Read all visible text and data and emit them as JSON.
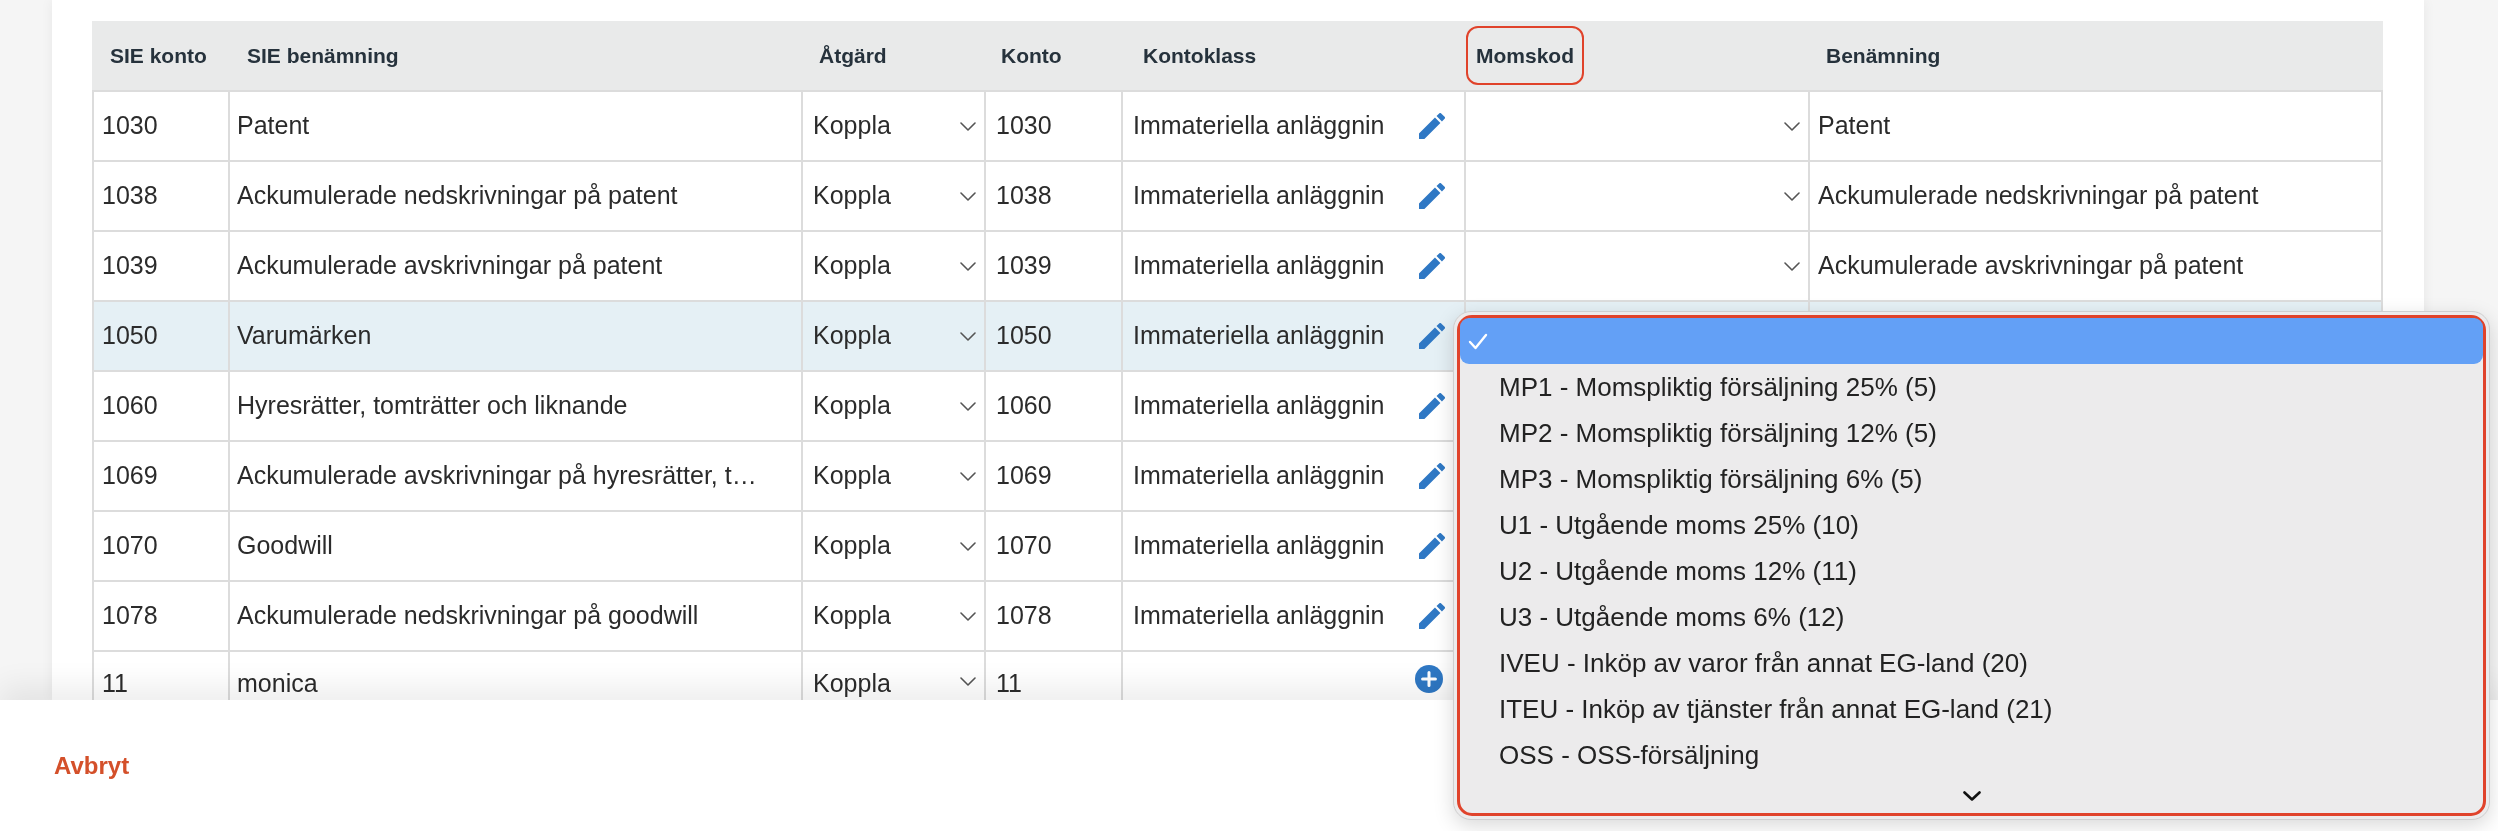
{
  "table": {
    "columns": [
      {
        "label": "SIE konto",
        "highlighted": false
      },
      {
        "label": "SIE benämning",
        "highlighted": false
      },
      {
        "label": "Åtgärd",
        "highlighted": false
      },
      {
        "label": "Konto",
        "highlighted": false
      },
      {
        "label": "Kontoklass",
        "highlighted": false
      },
      {
        "label": "Momskod",
        "highlighted": true
      },
      {
        "label": "Benämning",
        "highlighted": false
      }
    ],
    "rows": [
      {
        "sie_konto": "1030",
        "sie_benamning": "Patent",
        "atgard": "Koppla",
        "konto": "1030",
        "kontoklass": {
          "kind": "edit",
          "text": "Immateriella anläggnin"
        },
        "momskod": {
          "kind": "select"
        },
        "benamning": "Patent",
        "selected": false
      },
      {
        "sie_konto": "1038",
        "sie_benamning": "Ackumulerade nedskrivningar på patent",
        "atgard": "Koppla",
        "konto": "1038",
        "kontoklass": {
          "kind": "edit",
          "text": "Immateriella anläggnin"
        },
        "momskod": {
          "kind": "select"
        },
        "benamning": "Ackumulerade nedskrivningar på patent",
        "selected": false
      },
      {
        "sie_konto": "1039",
        "sie_benamning": "Ackumulerade avskrivningar på patent",
        "atgard": "Koppla",
        "konto": "1039",
        "kontoklass": {
          "kind": "edit",
          "text": "Immateriella anläggnin"
        },
        "momskod": {
          "kind": "select"
        },
        "benamning": "Ackumulerade avskrivningar på patent",
        "selected": false
      },
      {
        "sie_konto": "1050",
        "sie_benamning": "Varumärken",
        "atgard": "Koppla",
        "konto": "1050",
        "kontoklass": {
          "kind": "edit",
          "text": "Immateriella anläggnin"
        },
        "selected": true
      },
      {
        "sie_konto": "1060",
        "sie_benamning": "Hyresrätter, tomträtter och liknande",
        "atgard": "Koppla",
        "konto": "1060",
        "kontoklass": {
          "kind": "edit",
          "text": "Immateriella anläggnin"
        },
        "selected": false
      },
      {
        "sie_konto": "1069",
        "sie_benamning": "Ackumulerade avskrivningar på hyresrätter, t…",
        "atgard": "Koppla",
        "konto": "1069",
        "kontoklass": {
          "kind": "edit",
          "text": "Immateriella anläggnin"
        },
        "selected": false
      },
      {
        "sie_konto": "1070",
        "sie_benamning": "Goodwill",
        "atgard": "Koppla",
        "konto": "1070",
        "kontoklass": {
          "kind": "edit",
          "text": "Immateriella anläggnin"
        },
        "selected": false
      },
      {
        "sie_konto": "1078",
        "sie_benamning": "Ackumulerade nedskrivningar på goodwill",
        "atgard": "Koppla",
        "konto": "1078",
        "kontoklass": {
          "kind": "edit",
          "text": "Immateriella anläggnin"
        },
        "selected": false
      },
      {
        "sie_konto": "11",
        "sie_benamning": "monica",
        "atgard": "Koppla",
        "konto": "11",
        "kontoklass": {
          "kind": "add"
        },
        "selected": false
      }
    ]
  },
  "dropdown": {
    "highlighted": true,
    "options": [
      {
        "selected": true
      },
      {
        "label": "MP1 - Momspliktig försäljning 25% (5)",
        "selected": false
      },
      {
        "label": "MP2 - Momspliktig försäljning 12% (5)",
        "selected": false
      },
      {
        "label": "MP3 - Momspliktig försäljning 6% (5)",
        "selected": false
      },
      {
        "label": "U1 - Utgående moms 25% (10)",
        "selected": false
      },
      {
        "label": "U2 - Utgående moms 12% (11)",
        "selected": false
      },
      {
        "label": "U3 - Utgående moms 6% (12)",
        "selected": false
      },
      {
        "label": "IVEU - Inköp av varor från annat EG-land (20)",
        "selected": false
      },
      {
        "label": "ITEU - Inköp av tjänster från annat EG-land (21)",
        "selected": false
      },
      {
        "label": "OSS - OSS-försäljning",
        "selected": false
      }
    ]
  },
  "footer": {
    "cancel_button": "Avbryt"
  }
}
